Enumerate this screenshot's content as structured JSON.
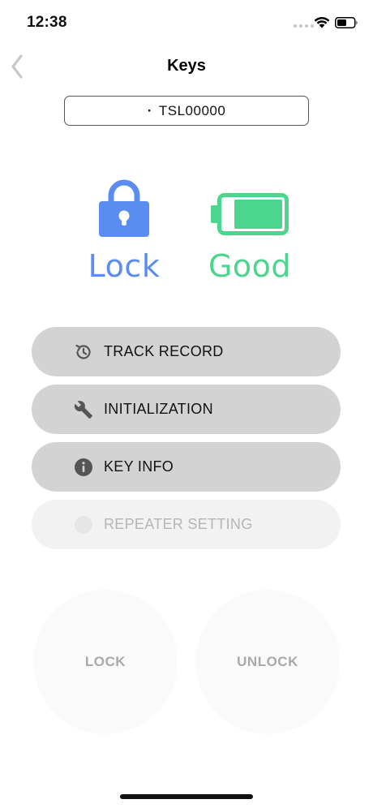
{
  "status_bar": {
    "time": "12:38"
  },
  "nav": {
    "title": "Keys"
  },
  "device": {
    "prefix": "·",
    "name": "TSL00000"
  },
  "status": {
    "lock_label": "Lock",
    "battery_label": "Good",
    "lock_color": "#5b8cf1",
    "battery_color": "#4cd68d"
  },
  "menu": [
    {
      "label": "TRACK RECORD",
      "icon": "history-icon",
      "enabled": true
    },
    {
      "label": "INITIALIZATION",
      "icon": "wrench-icon",
      "enabled": true
    },
    {
      "label": "KEY INFO",
      "icon": "info-icon",
      "enabled": true
    },
    {
      "label": "REPEATER SETTING",
      "icon": "repeater-icon",
      "enabled": false
    }
  ],
  "actions": {
    "lock_label": "LOCK",
    "unlock_label": "UNLOCK"
  }
}
